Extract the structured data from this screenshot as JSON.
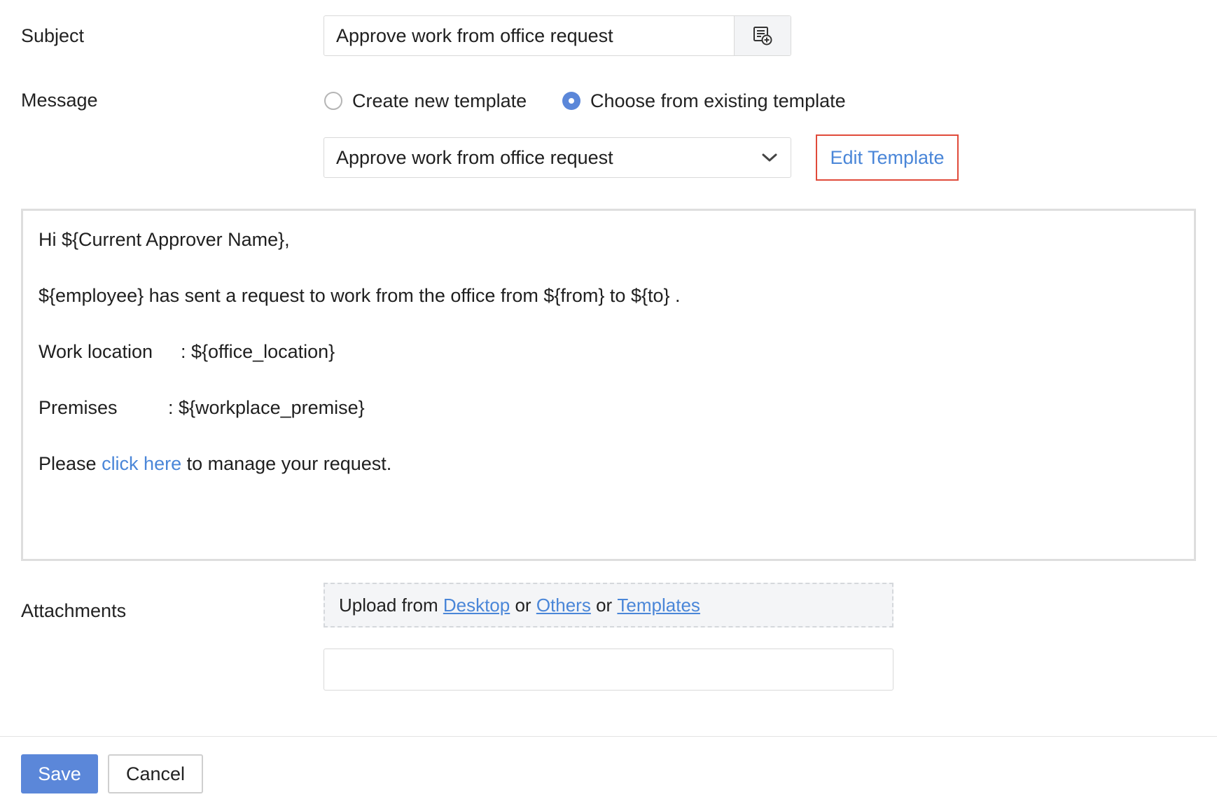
{
  "subject": {
    "label": "Subject",
    "value": "Approve work from office request",
    "insert_button_icon": "insert-field-icon"
  },
  "message": {
    "label": "Message",
    "options": [
      {
        "label": "Create new template",
        "checked": false
      },
      {
        "label": "Choose from existing template",
        "checked": true
      }
    ],
    "template_select": {
      "selected": "Approve work from office request",
      "icon": "chevron-down-icon"
    },
    "edit_template_label": "Edit Template",
    "edit_highlight_color": "#e04a3a"
  },
  "editor": {
    "greeting": "Hi ${Current Approver Name},",
    "line_request": "${employee} has sent a request to work from the office from ${from} to ${to} .",
    "work_location_label": "Work location",
    "work_location_value": ": ${office_location}",
    "premises_label": "Premises",
    "premises_value": ": ${workplace_premise}",
    "please_prefix": "Please ",
    "click_here": "click here",
    "please_suffix": " to manage your request."
  },
  "attachments": {
    "label": "Attachments",
    "upload_prefix": "Upload from ",
    "desktop": "Desktop",
    "or1": " or ",
    "others": "Others",
    "or2": " or ",
    "templates": "Templates"
  },
  "actions": {
    "save": "Save",
    "cancel": "Cancel"
  },
  "colors": {
    "accent": "#5b87d9",
    "link": "#4a86d8"
  }
}
